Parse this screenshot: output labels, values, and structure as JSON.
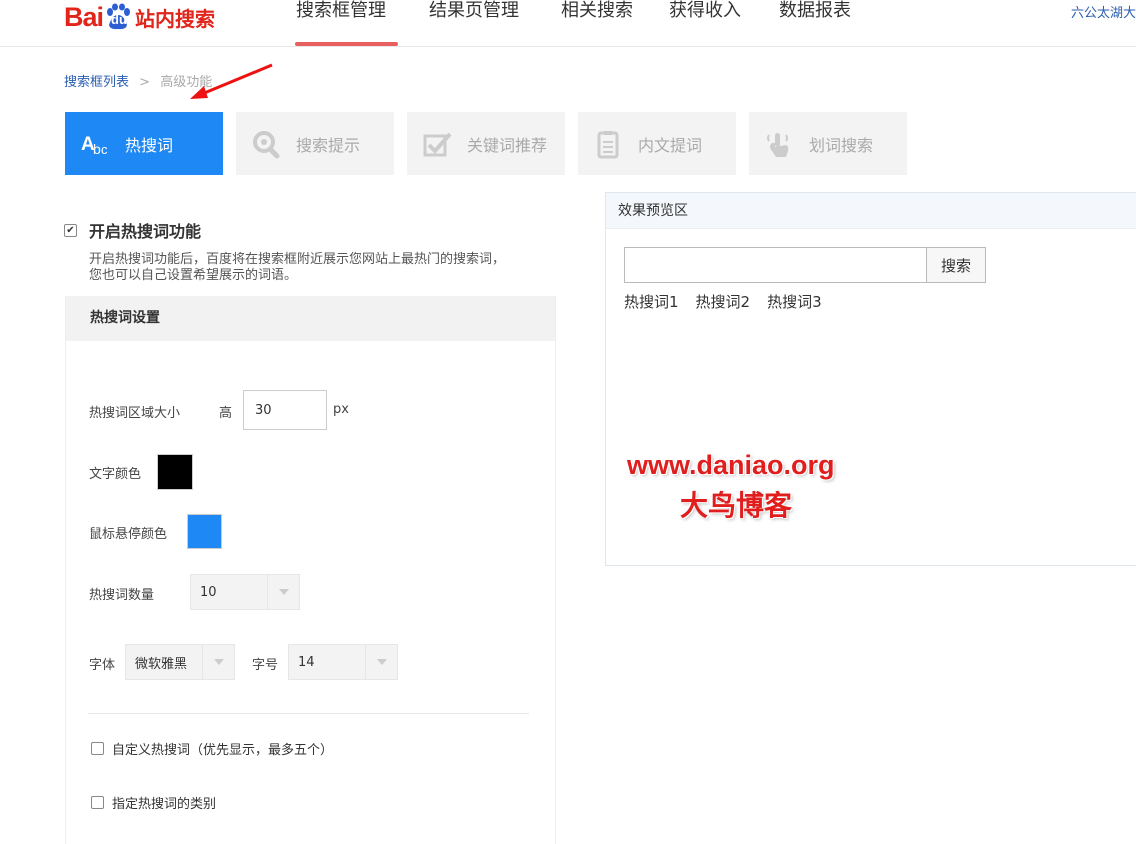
{
  "header": {
    "logo": {
      "bai": "Bai",
      "du": "du",
      "cn": "站内搜索"
    },
    "nav": [
      "搜索框管理",
      "结果页管理",
      "相关搜索",
      "获得收入",
      "数据报表"
    ],
    "active_nav": "搜索框管理",
    "user_link": "六公太湖大"
  },
  "breadcrumb": {
    "parent": "搜索框列表",
    "separator": ">",
    "current": "高级功能"
  },
  "tabs": [
    {
      "label": "热搜词",
      "icon": "abc-text-icon",
      "active": true
    },
    {
      "label": "搜索提示",
      "icon": "search-icon",
      "active": false
    },
    {
      "label": "关键词推荐",
      "icon": "checkbox-icon",
      "active": false
    },
    {
      "label": "内文提词",
      "icon": "document-icon",
      "active": false
    },
    {
      "label": "划词搜索",
      "icon": "pointer-hand-icon",
      "active": false
    }
  ],
  "enable": {
    "checked": true,
    "title": "开启热搜词功能",
    "desc_line1": "开启热搜词功能后，百度将在搜索框附近展示您网站上最热门的搜索词，",
    "desc_line2": "您也可以自己设置希望展示的词语。"
  },
  "settings": {
    "header": "热搜词设置",
    "area_size_label": "热搜词区域大小",
    "height_label": "高",
    "height_value": "30",
    "height_unit": "px",
    "text_color_label": "文字颜色",
    "text_color": "#000000",
    "hover_color_label": "鼠标悬停颜色",
    "hover_color": "#1e88f5",
    "count_label": "热搜词数量",
    "count_value": "10",
    "font_label": "字体",
    "font_value": "微软雅黑",
    "size_label": "字号",
    "size_value": "14",
    "custom_words_label": "自定义热搜词（优先显示，最多五个）",
    "category_label": "指定热搜词的类别"
  },
  "preview": {
    "header": "效果预览区",
    "search_button": "搜索",
    "hot_words": [
      "热搜词1",
      "热搜词2",
      "热搜词3"
    ]
  },
  "watermark": {
    "url": "www.daniao.org",
    "name": "大鸟博客"
  },
  "colors": {
    "accent": "#1e88f5",
    "brand_red": "#e1251b",
    "nav_underline": "#e85f5f",
    "link": "#2a5db0"
  }
}
